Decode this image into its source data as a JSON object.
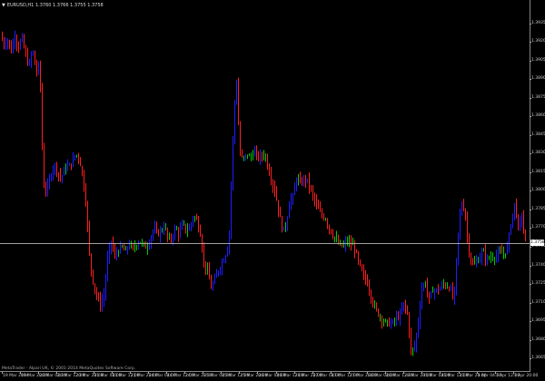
{
  "window": {
    "symbol_header": "EURUSD,H1  1.3760 1.3766 1.3755 1.3758",
    "copyright": "MetaTrader - Alpari UK, © 2001-2014 MetaQuotes Software Corp."
  },
  "colors": {
    "background": "#000000",
    "bull": "#1e1eff",
    "bear": "#ff1e1e",
    "neutral": "#00cc00",
    "current_price_line": "#bdbdbd"
  },
  "price_axis": {
    "labels": [
      "1.3935",
      "1.3920",
      "1.3905",
      "1.3890",
      "1.3875",
      "1.3860",
      "1.3845",
      "1.3830",
      "1.3815",
      "1.3800",
      "1.3785",
      "1.3770",
      "1.3755",
      "1.3740",
      "1.3725",
      "1.3710",
      "1.3695",
      "1.3680",
      "1.3665"
    ],
    "min": 1.366,
    "max": 1.3945,
    "current_price": "1.3758"
  },
  "time_axis": {
    "labels": [
      "19 Mar 2014",
      "19 Mar 20:00",
      "20 Mar 04:00",
      "20 Mar 12:00",
      "20 Mar 20:00",
      "21 Mar 04:00",
      "21 Mar 12:00",
      "21 Mar 20:00",
      "24 Mar 04:00",
      "24 Mar 12:00",
      "24 Mar 20:00",
      "25 Mar 04:00",
      "25 Mar 12:00",
      "25 Mar 20:00",
      "26 Mar 04:00",
      "26 Mar 12:00",
      "26 Mar 20:00",
      "27 Mar 04:00",
      "27 Mar 12:00",
      "27 Mar 20:00",
      "28 Mar 04:00",
      "28 Mar 12:00",
      "28 Mar 20:00",
      "31 Mar 04:00",
      "31 Mar 12:00",
      "31 Mar 20:00",
      "1 Apr 04:00",
      "1 Apr 12:00",
      "1 Apr 20:00"
    ]
  },
  "chart_data": {
    "type": "bar",
    "timeframe": "H1",
    "ohlc_path": [
      1.3925,
      1.3918,
      1.3922,
      1.3912,
      1.3926,
      1.3915,
      1.3924,
      1.391,
      1.39,
      1.3915,
      1.3895,
      1.3903,
      1.3805,
      1.38,
      1.3812,
      1.3822,
      1.3815,
      1.381,
      1.3818,
      1.382,
      1.3822,
      1.383,
      1.3827,
      1.3812,
      1.379,
      1.3745,
      1.3726,
      1.3715,
      1.3708,
      1.3716,
      1.3745,
      1.376,
      1.3747,
      1.3752,
      1.3755,
      1.375,
      1.3758,
      1.3752,
      1.3757,
      1.376,
      1.3756,
      1.3754,
      1.3762,
      1.377,
      1.3765,
      1.3768,
      1.3772,
      1.376,
      1.3762,
      1.377,
      1.3765,
      1.3774,
      1.3768,
      1.377,
      1.378,
      1.3776,
      1.3765,
      1.3742,
      1.3735,
      1.3722,
      1.3728,
      1.3736,
      1.3742,
      1.3748,
      1.376,
      1.3835,
      1.3895,
      1.383,
      1.3825,
      1.383,
      1.3826,
      1.3832,
      1.3827,
      1.3828,
      1.383,
      1.3818,
      1.3808,
      1.3798,
      1.3782,
      1.3768,
      1.3772,
      1.3793,
      1.3795,
      1.3812,
      1.3805,
      1.381,
      1.3808,
      1.38,
      1.3792,
      1.3785,
      1.378,
      1.3778,
      1.377,
      1.3765,
      1.376,
      1.3756,
      1.3755,
      1.376,
      1.3757,
      1.3755,
      1.3745,
      1.3736,
      1.373,
      1.3724,
      1.3712,
      1.3705,
      1.37,
      1.3696,
      1.3694,
      1.3693,
      1.3694,
      1.3698,
      1.37,
      1.371,
      1.37,
      1.367,
      1.3675,
      1.3695,
      1.3722,
      1.3726,
      1.3712,
      1.372,
      1.372,
      1.3721,
      1.3725,
      1.3723,
      1.3722,
      1.371,
      1.376,
      1.379,
      1.3785,
      1.3755,
      1.374,
      1.3742,
      1.3745,
      1.3752,
      1.3745,
      1.3746,
      1.3747,
      1.3748,
      1.375,
      1.3749,
      1.3755,
      1.3775,
      1.379,
      1.377,
      1.378,
      1.3758
    ]
  }
}
